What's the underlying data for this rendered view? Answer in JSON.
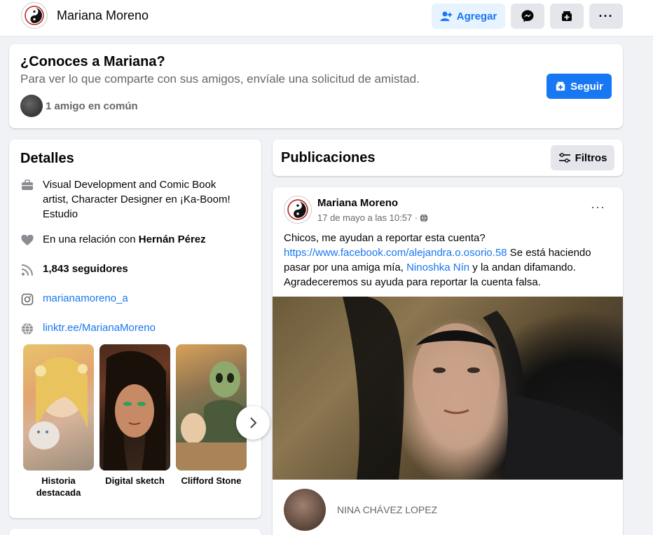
{
  "header": {
    "profile_name": "Mariana Moreno",
    "add_label": "Agregar"
  },
  "know_card": {
    "title": "¿Conoces a Mariana?",
    "subtitle": "Para ver lo que comparte con sus amigos, envíale una solicitud de amistad.",
    "mutual": "1 amigo en común",
    "follow_label": "Seguir"
  },
  "details": {
    "title": "Detalles",
    "work": "Visual Development and Comic Book artist, Character Designer en ¡Ka-Boom! Estudio",
    "relationship_prefix": "En una relación con ",
    "relationship_name": "Hernán Pérez",
    "followers": "1,843 seguidores",
    "instagram": "marianamoreno_a",
    "website": "linktr.ee/MarianaMoreno",
    "highlights": [
      {
        "label": "Historia destacada"
      },
      {
        "label": "Digital sketch"
      },
      {
        "label": "Clifford Stone"
      }
    ]
  },
  "publications": {
    "title": "Publicaciones",
    "filter_label": "Filtros"
  },
  "post": {
    "author": "Mariana Moreno",
    "time": "17 de mayo a las 10:57 ·",
    "text_1": "Chicos, me ayudan a reportar esta cuenta? ",
    "link_url": "https://www.facebook.com/alejandra.o.osorio.58",
    "text_2": " Se está haciendo pasar por una amiga mía, ",
    "tagged": "Ninoshka Nín",
    "text_3": " y la andan difamando. Agradeceremos su ayuda para reportar la cuenta falsa.",
    "comment_name": "NINA CHÁVEZ LOPEZ"
  },
  "colors": {
    "accent": "#1877f2",
    "accent_light": "#e7f3ff",
    "background": "#f0f2f5",
    "secondary_text": "#65676b"
  }
}
